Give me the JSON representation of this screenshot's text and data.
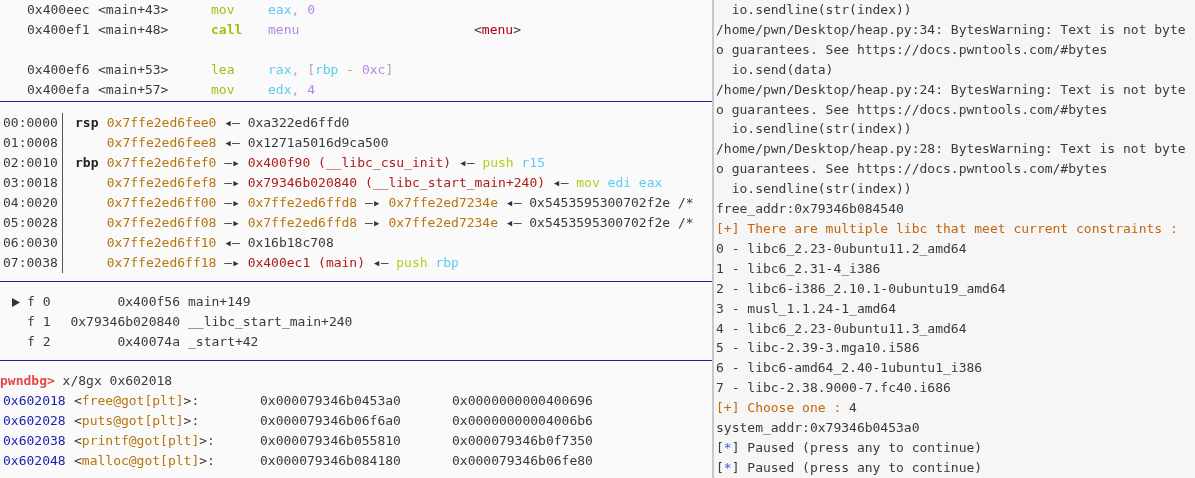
{
  "disassembly": [
    [
      {
        "address": "0x400eec",
        "symbol": "<main+43>",
        "mnemonic": "mov",
        "branch": false,
        "operands": [
          {
            "text": "eax",
            "kind": "reg"
          },
          {
            "text": ", ",
            "kind": "punct"
          },
          {
            "text": "0",
            "kind": "num"
          }
        ]
      },
      {
        "address": "0x400ef1",
        "symbol": "<main+48>",
        "mnemonic": "call",
        "branch": true,
        "operands": [
          {
            "text": "menu",
            "kind": "sym"
          }
        ],
        "comment": [
          {
            "text": "<",
            "kind": "plain"
          },
          {
            "text": "menu",
            "kind": "func"
          },
          {
            "text": ">",
            "kind": "plain"
          }
        ]
      }
    ],
    [
      {
        "address": "0x400ef6",
        "symbol": "<main+53>",
        "mnemonic": "lea",
        "branch": false,
        "operands": [
          {
            "text": "rax",
            "kind": "reg"
          },
          {
            "text": ", [",
            "kind": "punct"
          },
          {
            "text": "rbp",
            "kind": "reg"
          },
          {
            "text": " - ",
            "kind": "punct"
          },
          {
            "text": "0xc",
            "kind": "num"
          },
          {
            "text": "]",
            "kind": "punct"
          }
        ]
      },
      {
        "address": "0x400efa",
        "symbol": "<main+57>",
        "mnemonic": "mov",
        "branch": false,
        "operands": [
          {
            "text": "edx",
            "kind": "reg"
          },
          {
            "text": ", ",
            "kind": "punct"
          },
          {
            "text": "4",
            "kind": "num"
          }
        ]
      }
    ]
  ],
  "stack": [
    {
      "offset": "00:0000",
      "register": "rsp",
      "chain": [
        {
          "text": "0x7ffe2ed6fee0",
          "kind": "stack"
        },
        {
          "text": "◂—",
          "kind": "arrow"
        },
        {
          "text": "0xa322ed6ffd0",
          "kind": "data"
        }
      ]
    },
    {
      "offset": "01:0008",
      "chain": [
        {
          "text": "0x7ffe2ed6fee8",
          "kind": "stack"
        },
        {
          "text": "◂—",
          "kind": "arrow"
        },
        {
          "text": "0x1271a5016d9ca500",
          "kind": "data"
        }
      ]
    },
    {
      "offset": "02:0010",
      "register": "rbp",
      "chain": [
        {
          "text": "0x7ffe2ed6fef0",
          "kind": "stack"
        },
        {
          "text": "—▸",
          "kind": "arrow"
        },
        {
          "text": "0x400f90 (__libc_csu_init)",
          "kind": "code"
        },
        {
          "text": "◂—",
          "kind": "arrow"
        },
        {
          "text": "push",
          "kind": "instr"
        },
        {
          "text": "r15",
          "kind": "reg"
        }
      ]
    },
    {
      "offset": "03:0018",
      "chain": [
        {
          "text": "0x7ffe2ed6fef8",
          "kind": "stack"
        },
        {
          "text": "—▸",
          "kind": "arrow"
        },
        {
          "text": "0x79346b020840 (__libc_start_main+240)",
          "kind": "code"
        },
        {
          "text": "◂—",
          "kind": "arrow"
        },
        {
          "text": "mov",
          "kind": "instr"
        },
        {
          "text": "edi",
          "kind": "reg"
        },
        {
          "text": "eax",
          "kind": "reg"
        }
      ]
    },
    {
      "offset": "04:0020",
      "chain": [
        {
          "text": "0x7ffe2ed6ff00",
          "kind": "stack"
        },
        {
          "text": "—▸",
          "kind": "arrow"
        },
        {
          "text": "0x7ffe2ed6ffd8",
          "kind": "stack"
        },
        {
          "text": "—▸",
          "kind": "arrow"
        },
        {
          "text": "0x7ffe2ed7234e",
          "kind": "stack"
        },
        {
          "text": "◂—",
          "kind": "arrow"
        },
        {
          "text": "0x5453595300702f2e /*",
          "kind": "data"
        }
      ]
    },
    {
      "offset": "05:0028",
      "chain": [
        {
          "text": "0x7ffe2ed6ff08",
          "kind": "stack"
        },
        {
          "text": "—▸",
          "kind": "arrow"
        },
        {
          "text": "0x7ffe2ed6ffd8",
          "kind": "stack"
        },
        {
          "text": "—▸",
          "kind": "arrow"
        },
        {
          "text": "0x7ffe2ed7234e",
          "kind": "stack"
        },
        {
          "text": "◂—",
          "kind": "arrow"
        },
        {
          "text": "0x5453595300702f2e /*",
          "kind": "data"
        }
      ]
    },
    {
      "offset": "06:0030",
      "chain": [
        {
          "text": "0x7ffe2ed6ff10",
          "kind": "stack"
        },
        {
          "text": "◂—",
          "kind": "arrow"
        },
        {
          "text": "0x16b18c708",
          "kind": "data"
        }
      ]
    },
    {
      "offset": "07:0038",
      "chain": [
        {
          "text": "0x7ffe2ed6ff18",
          "kind": "stack"
        },
        {
          "text": "—▸",
          "kind": "arrow"
        },
        {
          "text": "0x400ec1 (main)",
          "kind": "code"
        },
        {
          "text": "◂—",
          "kind": "arrow"
        },
        {
          "text": "push",
          "kind": "instr"
        },
        {
          "text": "rbp",
          "kind": "reg"
        }
      ]
    }
  ],
  "backtrace": [
    {
      "selected": true,
      "frame": "f 0",
      "address": "0x400f56",
      "symbol": "main+149"
    },
    {
      "selected": false,
      "frame": "f 1",
      "address": "0x79346b020840",
      "symbol": "__libc_start_main+240"
    },
    {
      "selected": false,
      "frame": "f 2",
      "address": "0x40074a",
      "symbol": "_start+42"
    }
  ],
  "prompt": {
    "label": "pwndbg>",
    "command": "x/8gx 0x602018"
  },
  "memory": [
    {
      "address": "0x602018",
      "symbol": [
        {
          "text": "<",
          "kind": "plain"
        },
        {
          "text": "free@got[plt]",
          "kind": "got"
        },
        {
          "text": ">:",
          "kind": "plain"
        }
      ],
      "values": [
        "0x000079346b0453a0",
        "0x0000000000400696"
      ]
    },
    {
      "address": "0x602028",
      "symbol": [
        {
          "text": "<",
          "kind": "plain"
        },
        {
          "text": "puts@got[plt]",
          "kind": "got"
        },
        {
          "text": ">:",
          "kind": "plain"
        }
      ],
      "values": [
        "0x000079346b06f6a0",
        "0x00000000004006b6"
      ]
    },
    {
      "address": "0x602038",
      "symbol": [
        {
          "text": "<",
          "kind": "plain"
        },
        {
          "text": "printf@got[plt]",
          "kind": "got"
        },
        {
          "text": ">:",
          "kind": "plain"
        }
      ],
      "values": [
        "0x000079346b055810",
        "0x000079346b0f7350"
      ]
    },
    {
      "address": "0x602048",
      "symbol": [
        {
          "text": "<",
          "kind": "plain"
        },
        {
          "text": "malloc@got[plt]",
          "kind": "got"
        },
        {
          "text": ">:",
          "kind": "plain"
        }
      ],
      "values": [
        "0x000079346b084180",
        "0x000079346b06fe80"
      ]
    }
  ],
  "output": [
    [
      {
        "text": "  io.sendline(str(index))",
        "kind": "plain"
      }
    ],
    [
      {
        "text": "/home/pwn/Desktop/heap.py:34: BytesWarning: Text is not byte",
        "kind": "plain"
      }
    ],
    [
      {
        "text": "o guarantees. See https://docs.pwntools.com/#bytes",
        "kind": "plain"
      }
    ],
    [
      {
        "text": "  io.send(data)",
        "kind": "plain"
      }
    ],
    [
      {
        "text": "/home/pwn/Desktop/heap.py:24: BytesWarning: Text is not byte",
        "kind": "plain"
      }
    ],
    [
      {
        "text": "o guarantees. See https://docs.pwntools.com/#bytes",
        "kind": "plain"
      }
    ],
    [
      {
        "text": "  io.sendline(str(index))",
        "kind": "plain"
      }
    ],
    [
      {
        "text": "/home/pwn/Desktop/heap.py:28: BytesWarning: Text is not byte",
        "kind": "plain"
      }
    ],
    [
      {
        "text": "o guarantees. See https://docs.pwntools.com/#bytes",
        "kind": "plain"
      }
    ],
    [
      {
        "text": "  io.sendline(str(index))",
        "kind": "plain"
      }
    ],
    [
      {
        "text": "free_addr:0x79346b084540",
        "kind": "plain"
      }
    ],
    [
      {
        "text": "[+] There are multiple libc that meet current constraints :",
        "kind": "info"
      }
    ],
    [
      {
        "text": "0 - libc6_2.23-0ubuntu11.2_amd64",
        "kind": "plain"
      }
    ],
    [
      {
        "text": "1 - libc6_2.31-4_i386",
        "kind": "plain"
      }
    ],
    [
      {
        "text": "2 - libc6-i386_2.10.1-0ubuntu19_amd64",
        "kind": "plain"
      }
    ],
    [
      {
        "text": "3 - musl_1.1.24-1_amd64",
        "kind": "plain"
      }
    ],
    [
      {
        "text": "4 - libc6_2.23-0ubuntu11.3_amd64",
        "kind": "plain"
      }
    ],
    [
      {
        "text": "5 - libc-2.39-3.mga10.i586",
        "kind": "plain"
      }
    ],
    [
      {
        "text": "6 - libc6-amd64_2.40-1ubuntu1_i386",
        "kind": "plain"
      }
    ],
    [
      {
        "text": "7 - libc-2.38.9000-7.fc40.i686",
        "kind": "plain"
      }
    ],
    [
      {
        "text": "[+] Choose one :",
        "kind": "info"
      },
      {
        "text": " 4",
        "kind": "plain"
      }
    ],
    [
      {
        "text": "system_addr:0x79346b0453a0",
        "kind": "plain"
      }
    ],
    [
      {
        "text": "[",
        "kind": "plain"
      },
      {
        "text": "*",
        "kind": "star"
      },
      {
        "text": "] Paused (press any to continue)",
        "kind": "plain"
      }
    ],
    [
      {
        "text": "[",
        "kind": "plain"
      },
      {
        "text": "*",
        "kind": "star"
      },
      {
        "text": "] Paused (press any to continue)",
        "kind": "plain"
      }
    ]
  ]
}
